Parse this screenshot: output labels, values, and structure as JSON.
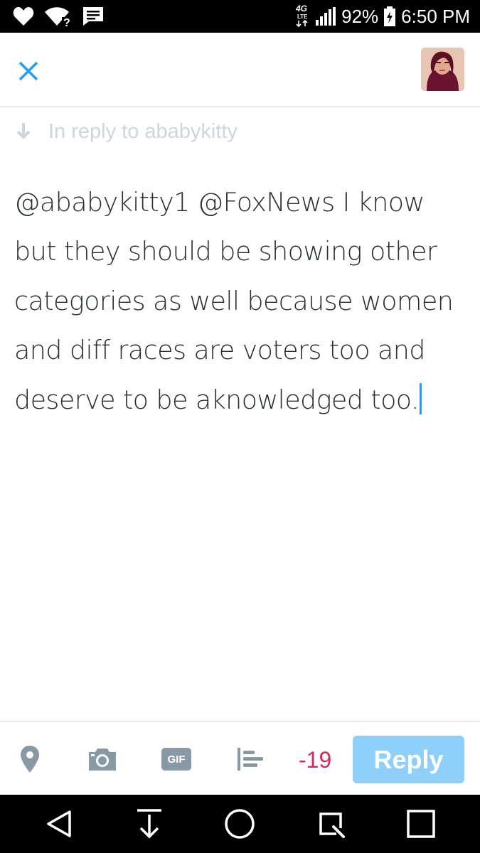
{
  "status_bar": {
    "network_label": "4G LTE",
    "battery": "92%",
    "time": "6:50 PM"
  },
  "compose": {
    "reply_to": "In reply to ababykitty",
    "text": "@ababykitty1 @FoxNews I know but they should be showing other categories as well because women and diff races are voters too and deserve to be aknowledged too."
  },
  "toolbar": {
    "gif_label": "GIF",
    "char_counter": "-19",
    "reply_label": "Reply"
  },
  "colors": {
    "accent": "#1da1f2",
    "reply_disabled": "#8ed0f9",
    "counter_over_limit": "#e0245e",
    "muted": "#ccd6dd",
    "icon_gray": "#8899a6"
  },
  "icons": [
    "heart-icon",
    "wifi-icon",
    "message-icon",
    "signal-icon",
    "battery-icon",
    "close-icon",
    "reply-arrow-icon",
    "location-icon",
    "camera-icon",
    "gif-icon",
    "poll-icon",
    "back-icon",
    "download-icon",
    "home-icon",
    "search-icon",
    "recents-icon"
  ]
}
